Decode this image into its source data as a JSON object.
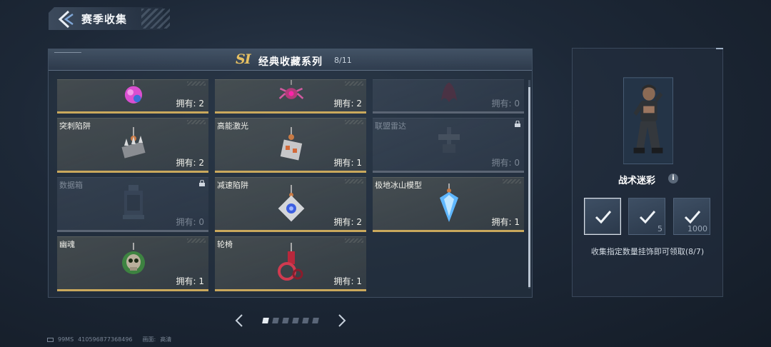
{
  "header": {
    "title": "赛季收集"
  },
  "collection": {
    "badge": "SI",
    "title": "经典收藏系列",
    "progress": "8/11"
  },
  "items": [
    {
      "name": "",
      "owned": "拥有: 2",
      "locked": false,
      "icon": "pink-orb-pendant"
    },
    {
      "name": "",
      "owned": "拥有: 2",
      "locked": false,
      "icon": "spider-pendant"
    },
    {
      "name": "",
      "owned": "拥有: 0",
      "locked": true,
      "icon": "tentacle-pendant"
    },
    {
      "name": "突刺陷阱",
      "owned": "拥有: 2",
      "locked": false,
      "icon": "spike-trap-pendant"
    },
    {
      "name": "高能激光",
      "owned": "拥有: 1",
      "locked": false,
      "icon": "laser-pendant"
    },
    {
      "name": "联盟雷达",
      "owned": "拥有: 0",
      "locked": true,
      "icon": "radar-pendant"
    },
    {
      "name": "数据箱",
      "owned": "拥有: 0",
      "locked": true,
      "icon": "data-box-pendant"
    },
    {
      "name": "减速陷阱",
      "owned": "拥有: 2",
      "locked": false,
      "icon": "slow-trap-pendant"
    },
    {
      "name": "极地冰山模型",
      "owned": "拥有: 1",
      "locked": false,
      "icon": "iceberg-pendant"
    },
    {
      "name": "幽魂",
      "owned": "拥有: 1",
      "locked": false,
      "icon": "ghost-skull-pendant"
    },
    {
      "name": "轮椅",
      "owned": "拥有: 1",
      "locked": false,
      "icon": "wheelchair-pendant"
    }
  ],
  "pager": {
    "pages": 6,
    "current": 1
  },
  "reward": {
    "name": "战术迷彩",
    "info": "i",
    "tiers": [
      {
        "count": "",
        "selected": true
      },
      {
        "count": "5",
        "selected": false
      },
      {
        "count": "1000",
        "selected": false
      }
    ],
    "description": "收集指定数量挂饰即可领取(8/7)"
  },
  "footer": {
    "ping": "99MS",
    "uid": "410596877368496",
    "quality_label": "画面:",
    "quality": "高清"
  },
  "colors": {
    "accent_gold": "#c9a85c",
    "badge_gold": "#e6c062",
    "locked": "#5b6574"
  }
}
